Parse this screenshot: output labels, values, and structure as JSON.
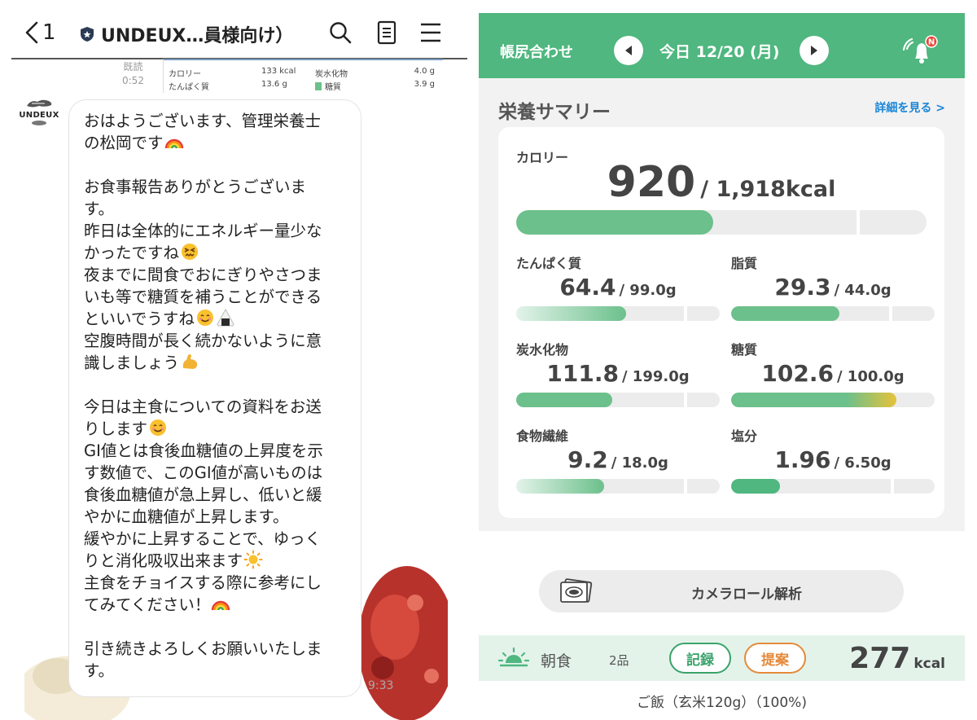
{
  "chat": {
    "back_count": "1",
    "title": "UNDEUX…員様向け）",
    "read_label": "既読",
    "read_time": "0:52",
    "prev_card": {
      "rows": [
        {
          "name1": "カロリー",
          "val1": "133 kcal",
          "name2": "炭水化物",
          "val2": "4.0 g"
        },
        {
          "name1": "たんぱく質",
          "val1": "13.6 g",
          "name2": "糖質",
          "val2": "3.9 g"
        }
      ]
    },
    "avatar_text": "UNDEUX",
    "message_lines": [
      "おはようございます、管理栄養士",
      "の松岡です",
      "",
      "お食事報告ありがとうございま",
      "す。",
      "昨日は全体的にエネルギー量少な",
      "かったですね",
      "夜までに間食でおにぎりやさつま",
      "いも等で糖質を補うことができる",
      "といいでうすね",
      "空腹時間が長く続かないように意",
      "識しましょう",
      "",
      "今日は主食についての資料をお送",
      "りします",
      "GI値とは食後血糖値の上昇度を示",
      "す数値で、このGI値が高いものは",
      "食後血糖値が急上昇し、低いと緩",
      "やかに血糖値が上昇します。",
      "緩やかに上昇することで、ゆっく",
      "りと消化吸収出来ます",
      "主食をチョイスする際に参考にし",
      "てみてください！",
      "",
      "引き続きよろしくお願いいたしま",
      "す。"
    ],
    "message_time": "9:33"
  },
  "app": {
    "ledger_label": "帳尻合わせ",
    "date_label": "今日 12/20 (月)",
    "bell_badge": "N",
    "summary_title": "栄養サマリー",
    "detail_link": "詳細を見る >",
    "calorie": {
      "label": "カロリー",
      "value": "920",
      "target": "/ 1,918kcal",
      "progress": 0.48
    },
    "nutrients": [
      {
        "label": "たんぱく質",
        "value": "64.4",
        "target": "/ 99.0g",
        "progress": 0.54
      },
      {
        "label": "脂質",
        "value": "29.3",
        "target": "/ 44.0g",
        "progress": 0.53
      },
      {
        "label": "炭水化物",
        "value": "111.8",
        "target": "/ 199.0g",
        "progress": 0.47
      },
      {
        "label": "糖質",
        "value": "102.6",
        "target": "/ 100.0g",
        "progress": 0.81
      },
      {
        "label": "食物繊維",
        "value": "9.2",
        "target": "/ 18.0g",
        "progress": 0.43
      },
      {
        "label": "塩分",
        "value": "1.96",
        "target": "/ 6.50g",
        "progress": 0.24
      }
    ],
    "camera_button": "カメラロール解析",
    "meal": {
      "name": "朝食",
      "count": "2品",
      "record_button": "記録",
      "suggest_button": "提案",
      "kcal_value": "277",
      "kcal_unit": "kcal",
      "item_text": "ご飯（玄米120g）（100%)"
    }
  },
  "colors": {
    "accent_green": "#4fb77f",
    "link_blue": "#1a86d6",
    "suggest_orange": "#e58a3a"
  }
}
